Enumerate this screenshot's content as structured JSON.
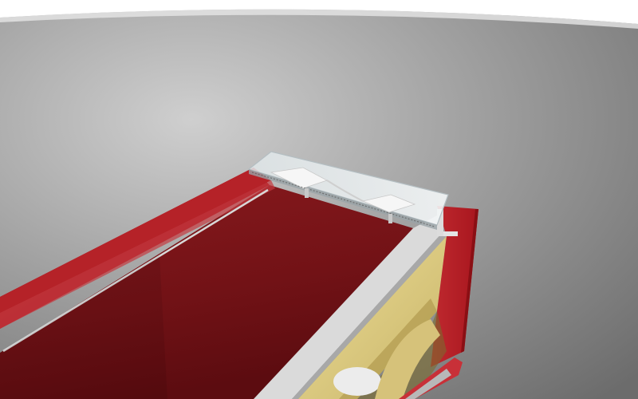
{
  "scene": {
    "subject": "red-box-with-glass-slide",
    "colors": {
      "floor_light": "#d4d4d4",
      "floor_mid": "#9a9a9a",
      "floor_dark": "#6e6e6e",
      "sky": "#ffffff",
      "box_top": "#7a1418",
      "box_top_dark": "#5c0d10",
      "box_side": "#a0141c",
      "box_side_light": "#c0282e",
      "box_end": "#b82028",
      "white_trim": "#dadada",
      "white_trim_shadow": "#9e9e9e",
      "cream_panel": "#e3d38a",
      "cream_panel_dark": "#b9a55a",
      "glass": "#e8eef0",
      "glass_edge": "#b8c2c6"
    }
  }
}
